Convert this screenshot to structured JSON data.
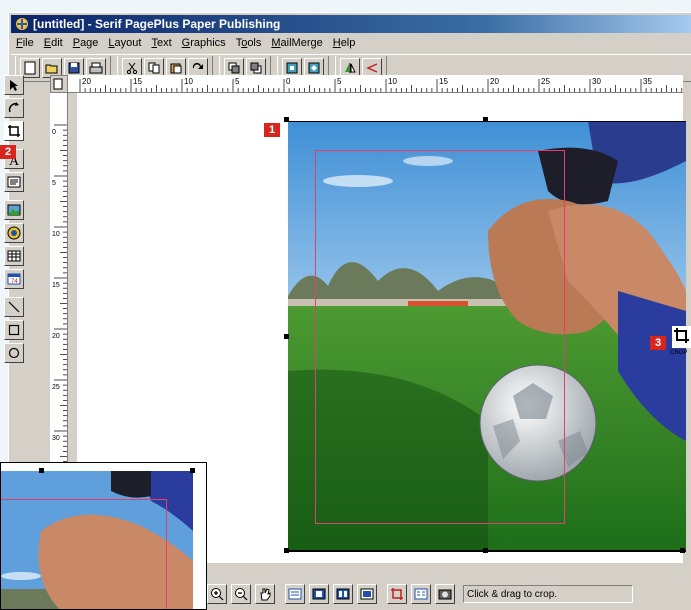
{
  "window": {
    "title": "[untitled] - Serif PagePlus Paper Publishing"
  },
  "menu": [
    "File",
    "Edit",
    "Page",
    "Layout",
    "Text",
    "Graphics",
    "Tools",
    "MailMerge",
    "Help"
  ],
  "menu_underline": [
    "F",
    "E",
    "P",
    "L",
    "T",
    "G",
    "o",
    "M",
    "H"
  ],
  "toolbar": {
    "groups": [
      [
        "new-icon",
        "open-icon",
        "save-icon",
        "print-icon"
      ],
      [
        "cut-icon",
        "copy-icon",
        "paste-icon",
        "update-icon"
      ],
      [
        "bring-front-icon",
        "send-back-icon"
      ],
      [
        "align-left-icon",
        "align-right-icon"
      ],
      [
        "flip-icon",
        "rotate-icon"
      ]
    ]
  },
  "tools": [
    "pointer-icon",
    "rotate-tool-icon",
    "crop-tool-icon",
    "text-icon",
    "frame-text-icon",
    "picture-icon",
    "import-icon",
    "table-icon",
    "calendar-icon",
    "line-icon",
    "rectangle-icon",
    "ellipse-icon"
  ],
  "ruler": {
    "h_labels": [
      "20",
      "15",
      "10",
      "5",
      "0",
      "5",
      "10",
      "15",
      "20",
      "25",
      "30",
      "35"
    ],
    "v_labels": [
      "0",
      "5",
      "10",
      "15",
      "20",
      "25",
      "30"
    ]
  },
  "badges": {
    "one": "1",
    "two": "2",
    "three": "3"
  },
  "crop_cursor": {
    "label": "CROP"
  },
  "status": {
    "text": "Click & drag to crop."
  },
  "colors": {
    "titlebar": "#0a246a",
    "badge": "#d7261e",
    "crop_frame": "#e0406a",
    "chrome": "#d4d0c8"
  }
}
